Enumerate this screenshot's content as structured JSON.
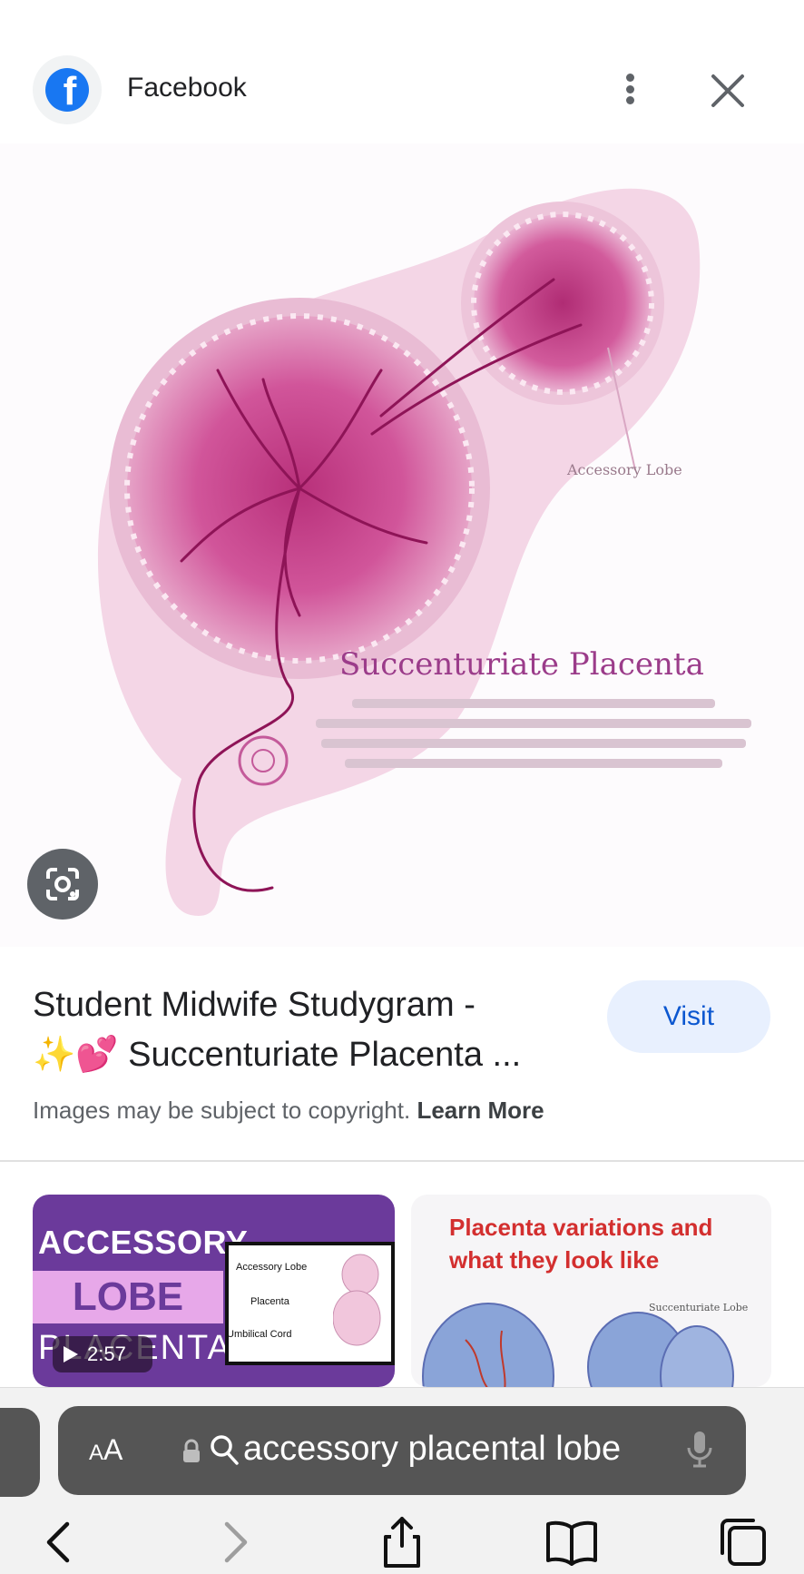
{
  "header": {
    "site_name": "Facebook",
    "icons": {
      "avatar": "facebook-logo",
      "more": "more-vertical-icon",
      "close": "close-icon"
    }
  },
  "hero": {
    "title": "Succenturiate Placenta",
    "label": "Accessory Lobe",
    "lens_icon": "lens-icon"
  },
  "result": {
    "title_line1": "Student Midwife Studygram -",
    "title_line2": "✨💕 Succenturiate Placenta ...",
    "visit_label": "Visit",
    "copyright_text": "Images may be subject to copyright.",
    "learn_more_label": "Learn More"
  },
  "thumbnails": [
    {
      "title": "ACCESSORY",
      "lobe": "LOBE",
      "placenta": "PLACENTA",
      "labels": [
        "Accessory Lobe",
        "Placenta",
        "Umbilical Cord"
      ],
      "duration": "2:57"
    },
    {
      "title": "Placenta variations and what they look like",
      "small_label": "Succenturiate Lobe"
    }
  ],
  "browser": {
    "aa_label_small": "A",
    "aa_label_big": "A",
    "url_text": "accessory placental lobe",
    "icons": [
      "back-icon",
      "forward-icon",
      "share-icon",
      "bookmarks-icon",
      "tabs-icon"
    ],
    "colors": {
      "bar": "#555555",
      "chrome": "#f2f2f2"
    }
  }
}
